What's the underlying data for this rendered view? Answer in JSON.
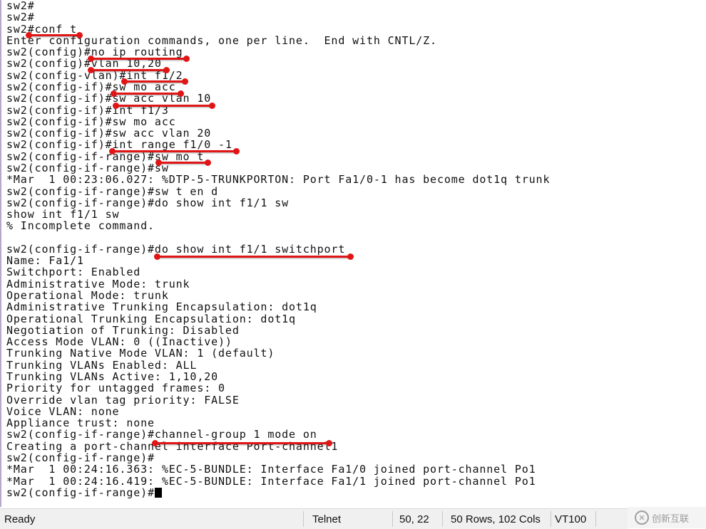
{
  "terminal": {
    "lines": [
      "sw2#",
      "sw2#",
      "sw2#conf t",
      "Enter configuration commands, one per line.  End with CNTL/Z.",
      "sw2(config)#no ip routing",
      "sw2(config)#vlan 10,20",
      "sw2(config-vlan)#int f1/2",
      "sw2(config-if)#sw mo acc",
      "sw2(config-if)#sw acc vlan 10",
      "sw2(config-if)#int f1/3",
      "sw2(config-if)#sw mo acc",
      "sw2(config-if)#sw acc vlan 20",
      "sw2(config-if)#int range f1/0 -1",
      "sw2(config-if-range)#sw mo t",
      "sw2(config-if-range)#sw",
      "*Mar  1 00:23:06.027: %DTP-5-TRUNKPORTON: Port Fa1/0-1 has become dot1q trunk",
      "sw2(config-if-range)#sw t en d",
      "sw2(config-if-range)#do show int f1/1 sw",
      "show int f1/1 sw",
      "% Incomplete command.",
      "",
      "sw2(config-if-range)#do show int f1/1 switchport",
      "Name: Fa1/1",
      "Switchport: Enabled",
      "Administrative Mode: trunk",
      "Operational Mode: trunk",
      "Administrative Trunking Encapsulation: dot1q",
      "Operational Trunking Encapsulation: dot1q",
      "Negotiation of Trunking: Disabled",
      "Access Mode VLAN: 0 ((Inactive))",
      "Trunking Native Mode VLAN: 1 (default)",
      "Trunking VLANs Enabled: ALL",
      "Trunking VLANs Active: 1,10,20",
      "Priority for untagged frames: 0",
      "Override vlan tag priority: FALSE",
      "Voice VLAN: none",
      "Appliance trust: none",
      "sw2(config-if-range)#channel-group 1 mode on",
      "Creating a port-channel interface Port-channel1",
      "sw2(config-if-range)#",
      "*Mar  1 00:24:16.363: %EC-5-BUNDLE: Interface Fa1/0 joined port-channel Po1",
      "*Mar  1 00:24:16.419: %EC-5-BUNDLE: Interface Fa1/1 joined port-channel Po1",
      "sw2(config-if-range)#"
    ],
    "annotation_color": "#e01515"
  },
  "status": {
    "state": "Ready",
    "protocol": "Telnet",
    "cursor_pos": "50,  22",
    "size": "50 Rows, 102 Cols",
    "emulation": "VT100"
  },
  "watermark": {
    "text": "创新互联"
  }
}
